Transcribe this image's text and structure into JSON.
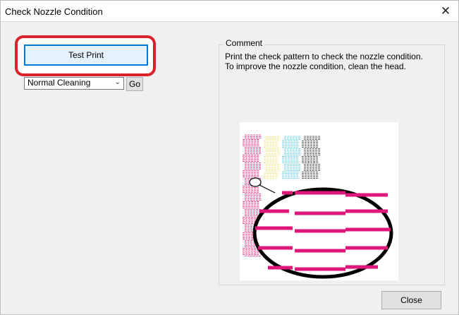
{
  "window": {
    "title": "Check Nozzle Condition",
    "close_glyph": "✕"
  },
  "left_panel": {
    "test_print_label": "Test Print",
    "cleaning_select_value": "Normal Cleaning",
    "go_label": "Go"
  },
  "comment": {
    "legend": "Comment",
    "line1": "Print the check pattern to check the nozzle condition.",
    "line2": "To improve the nozzle condition, clean the head."
  },
  "footer": {
    "close_label": "Close"
  },
  "colors": {
    "highlight": "#d8232a",
    "magenta": "#e0177a",
    "yellow": "#f4e57a",
    "cyan": "#5cc6e8",
    "black": "#333333",
    "focus_blue": "#0078d7"
  },
  "icons": {
    "close": "close-icon",
    "dropdown": "chevron-down-icon"
  }
}
